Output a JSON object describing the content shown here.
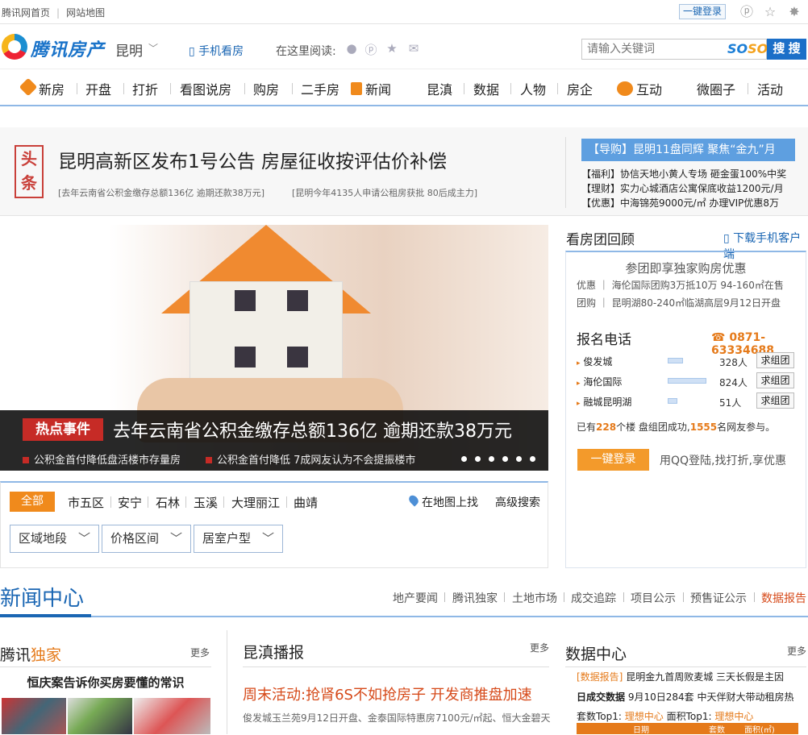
{
  "topbar": {
    "home": "腾讯网首页",
    "sitemap": "网站地图",
    "login": "一键登录"
  },
  "header": {
    "logo": "腾讯房产",
    "city": "昆明",
    "mobile": "手机看房",
    "read_label": "在这里阅读:",
    "search_placeholder": "请输入关键词",
    "soso_a": "SO",
    "soso_b": "SO",
    "search_btn": "搜 搜"
  },
  "nav": [
    "新房",
    "开盘",
    "打折",
    "看图说房",
    "购房",
    "二手房",
    "新闻",
    "昆滇",
    "数据",
    "人物",
    "房企",
    "互动",
    "微圈子",
    "活动"
  ],
  "headline": {
    "badge": "头条",
    "title": "昆明高新区发布1号公告 房屋征收按评估价补偿",
    "sub1": "[去年云南省公积金缴存总额136亿 逾期还款38万元]",
    "sub2": "[昆明今年4135人申请公租房获批 80后成主力]",
    "guide": "【导购】昆明11盘同辉 聚焦“金九”月",
    "lines": [
      "【福利】协信天地小黄人专场 砸金蛋100%中奖",
      "【理财】实力心城酒店公寓保底收益1200元/月",
      "【优惠】中海锦苑9000元/㎡ 办理VIP优惠8万"
    ]
  },
  "hero": {
    "tag": "热点事件",
    "title": "去年云南省公积金缴存总额136亿 逾期还款38万元",
    "sub1": "公积金首付降低盘活楼市存量房",
    "sub2": "公积金首付降低 7成网友认为不会提振楼市"
  },
  "filter": {
    "all": "全部",
    "areas": [
      "市五区",
      "安宁",
      "石林",
      "玉溪",
      "大理丽江",
      "曲靖"
    ],
    "map": "在地图上找",
    "advanced": "高级搜索",
    "selects": [
      "区域地段",
      "价格区间",
      "居室户型"
    ]
  },
  "tuan": {
    "title": "看房团回顾",
    "download": "下载手机客户端",
    "head": "参团即享独家购房优惠",
    "line1": "优惠 ｜ 海伦国际团购3万抵10万 94-160㎡在售",
    "line2": "团购 ｜ 昆明湖80-240㎡临湖高层9月12日开盘",
    "signup": "报名电话",
    "phone": "0871-63334688",
    "rows": [
      {
        "name": "俊发城",
        "count": "328人",
        "btn": "求组团",
        "pct": 0.4
      },
      {
        "name": "海伦国际",
        "count": "824人",
        "btn": "求组团",
        "pct": 1.0
      },
      {
        "name": "融城昆明湖",
        "count": "51人",
        "btn": "求组团",
        "pct": 0.25
      }
    ],
    "stats_a": "已有",
    "stats_n1": "228",
    "stats_b": "个楼 盘组团成功,",
    "stats_n2": "1555",
    "stats_c": "名网友参与。",
    "login": "一键登录",
    "tip": "用QQ登陆,找打折,享优惠"
  },
  "news": {
    "title": "新闻中心",
    "links": [
      "地产要闻",
      "腾讯独家",
      "土地市场",
      "成交追踪",
      "项目公示",
      "预售证公示",
      "数据报告"
    ]
  },
  "cols": {
    "excl_a": "腾讯",
    "excl_b": "独家",
    "more": "更多",
    "excl_head": "恒庆案告诉你买房要懂的常识",
    "cast": "昆滇播报",
    "cast_title": "周末活动:抢肾6S不如抢房子 开发商推盘加速",
    "cast_body": "俊发城玉兰苑9月12日开盘、金泰国际特惠房7100元/㎡起、恒大金碧天",
    "data": "数据中心",
    "d1_tag": "[数据报告]",
    "d1": "昆明金九首周败麦城 三天长假是主因",
    "d2_b": "日成交数据",
    "d2": "9月10日284套 中天伴财大带动租房热",
    "d3_a": "套数Top1:",
    "d3_b": "理想中心",
    "d3_c": "面积Top1:",
    "d3_d": "理想中心",
    "dt": [
      "日期",
      "套数",
      "面积(㎡)"
    ]
  },
  "colors": {
    "accent": "#1a66b3",
    "orange": "#f08a1c",
    "hot": "#c62b26"
  }
}
